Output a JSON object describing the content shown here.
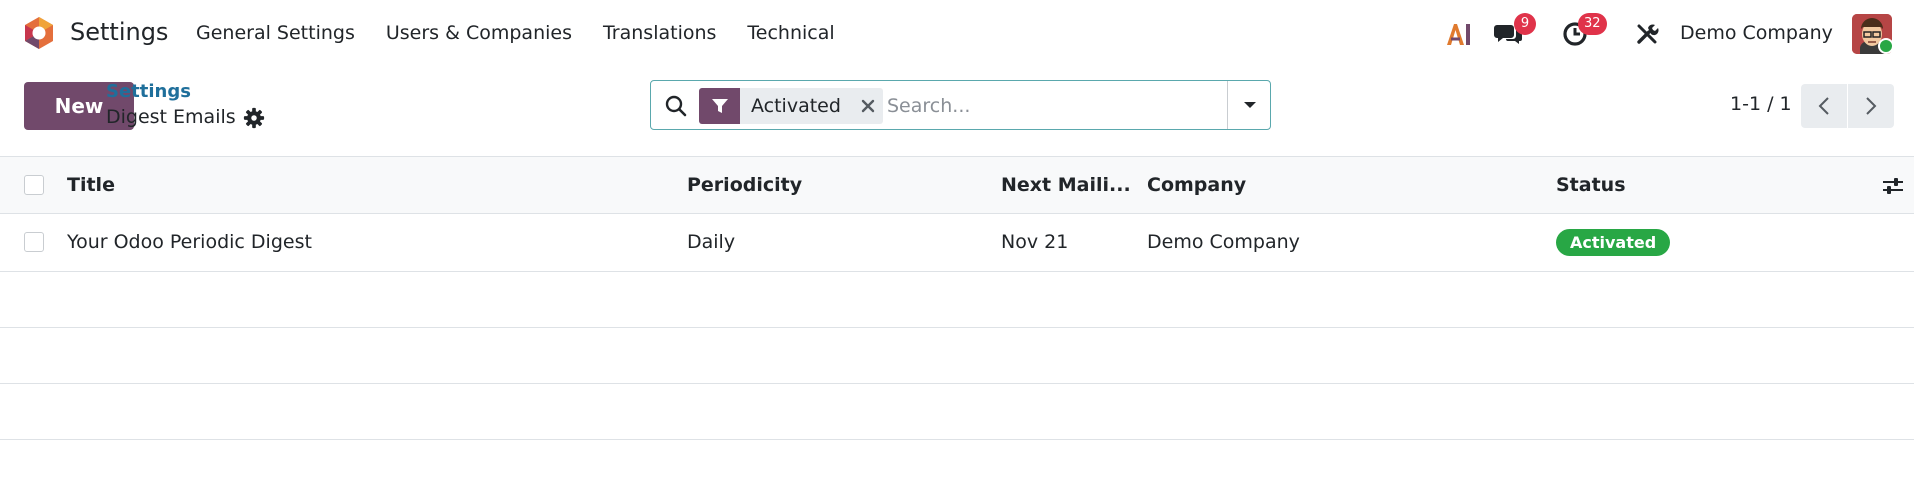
{
  "app": {
    "name": "Settings"
  },
  "menu": [
    "General Settings",
    "Users & Companies",
    "Translations",
    "Technical"
  ],
  "systray": {
    "ai_icon": "ai-icon",
    "messages_count": "9",
    "activities_count": "32",
    "company": "Demo Company"
  },
  "control": {
    "new_label": "New",
    "breadcrumb_parent": "Settings",
    "breadcrumb_current": "Digest Emails"
  },
  "search": {
    "facet_label": "Activated",
    "placeholder": "Search..."
  },
  "pager": {
    "value": "1-1 / 1"
  },
  "list": {
    "columns": [
      "Title",
      "Periodicity",
      "Next Maili...",
      "Company",
      "Status"
    ],
    "rows": [
      {
        "title": "Your Odoo Periodic Digest",
        "periodicity": "Daily",
        "next_mailing": "Nov 21",
        "company": "Demo Company",
        "status": "Activated"
      }
    ]
  },
  "colors": {
    "brand": "#71496b",
    "link": "#1f6f9b",
    "badge_red": "#e0334a",
    "status_green": "#28a745"
  }
}
